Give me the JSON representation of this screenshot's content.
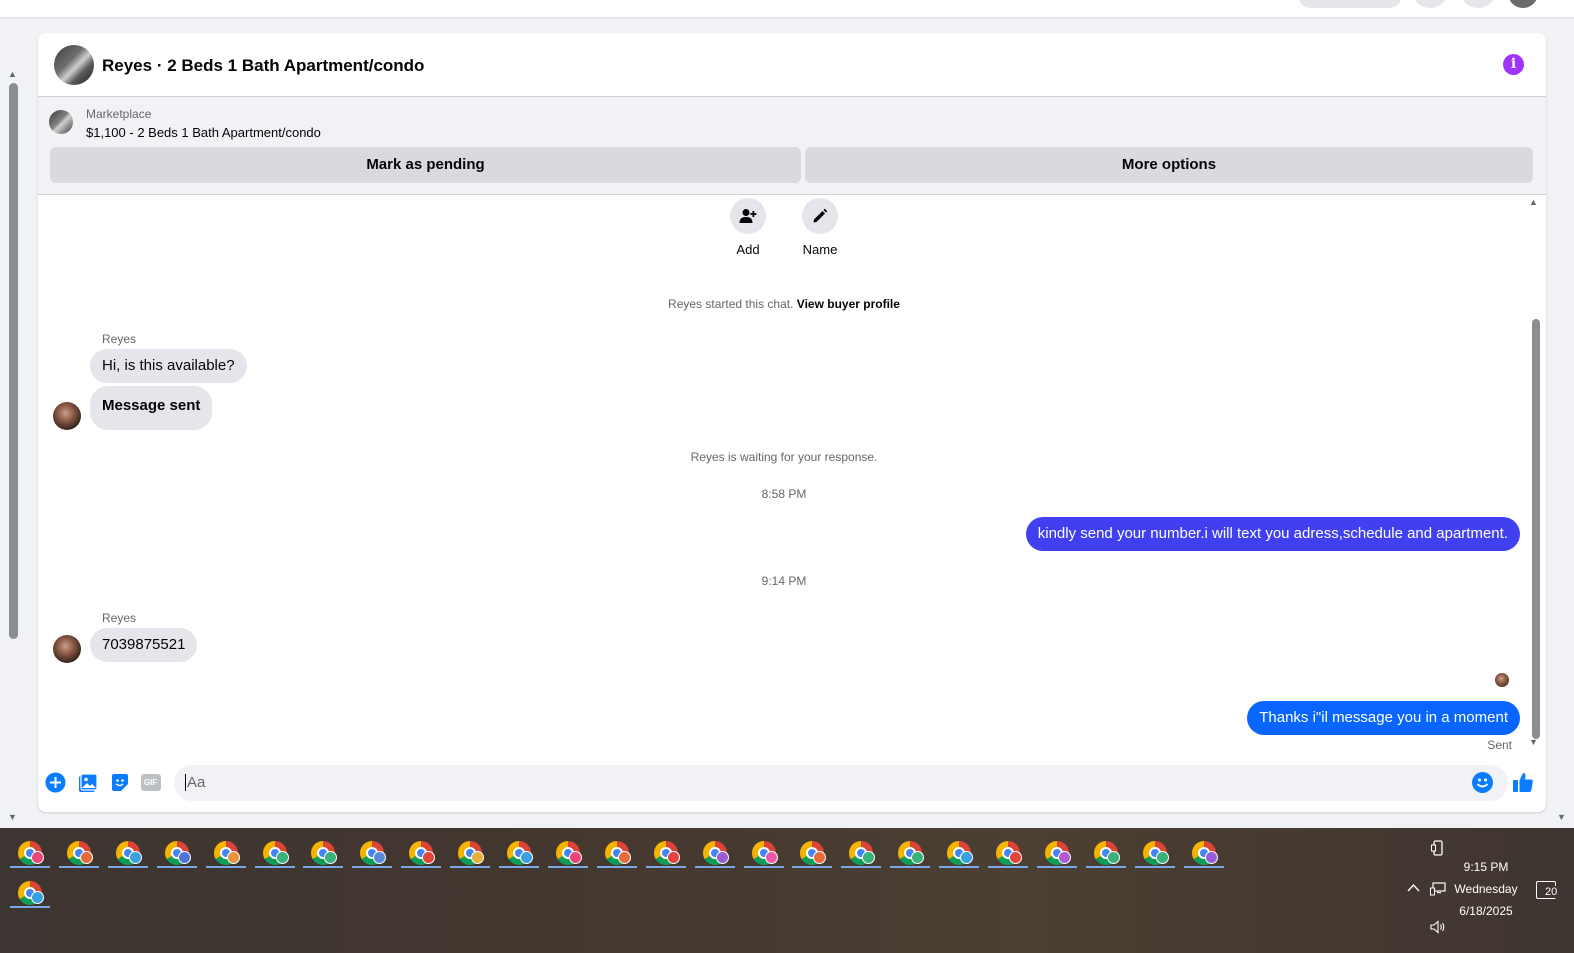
{
  "conversation": {
    "title": "Reyes · 2 Beds 1 Bath Apartment/condo",
    "listing": {
      "source": "Marketplace",
      "price_title": "$1,100 - 2 Beds 1 Bath Apartment/condo",
      "mark_pending_label": "Mark as pending",
      "more_options_label": "More options"
    },
    "actions": {
      "add_label": "Add",
      "name_label": "Name"
    },
    "started_text": "Reyes started this chat.",
    "view_profile_link": "View buyer profile",
    "messages": [
      {
        "sender": "Reyes",
        "text": "Hi, is this available?",
        "direction": "in"
      },
      {
        "sender": "Reyes",
        "text": "Message sent",
        "direction": "in"
      },
      {
        "system": "Reyes is waiting for your response."
      },
      {
        "timestamp": "8:58 PM"
      },
      {
        "text": "kindly send your number.i will text you adress,schedule and apartment.",
        "direction": "out"
      },
      {
        "timestamp": "9:14 PM"
      },
      {
        "sender": "Reyes",
        "text": "7039875521",
        "direction": "in"
      },
      {
        "text": "Thanks i\"il message you in a moment",
        "direction": "out",
        "status": "Sent"
      }
    ],
    "composer": {
      "placeholder": "Aa",
      "gif_label": "GIF"
    },
    "colors": {
      "accent_blue": "#0a7cff",
      "outgoing_purple": "#4040f0",
      "outgoing_blue": "#0866ff",
      "info_purple": "#a033ff"
    }
  },
  "taskbar": {
    "app_count": 26,
    "app_icon": "chrome-profile-icon",
    "profile_colors": [
      "#e8457a",
      "#e86a3b",
      "#3aa0e0",
      "#4e74d6",
      "#e8943b",
      "#3bb07a",
      "#3bb07a",
      "#5a8ad6",
      "#e0443b",
      "#e8b03b",
      "#3aa0e0",
      "#e8457a",
      "#e86a3b",
      "#e0443b",
      "#9b5ad6",
      "#e85aa8",
      "#e86a3b",
      "#3bb07a",
      "#3bb07a",
      "#3aa0e0",
      "#e0443b",
      "#b05ad6",
      "#3bb07a",
      "#3bb07a",
      "#9b5ad6",
      "#3aa0e0"
    ],
    "clock_time": "9:15 PM",
    "clock_day": "Wednesday",
    "clock_date": "6/18/2025",
    "notification_count": "20"
  }
}
